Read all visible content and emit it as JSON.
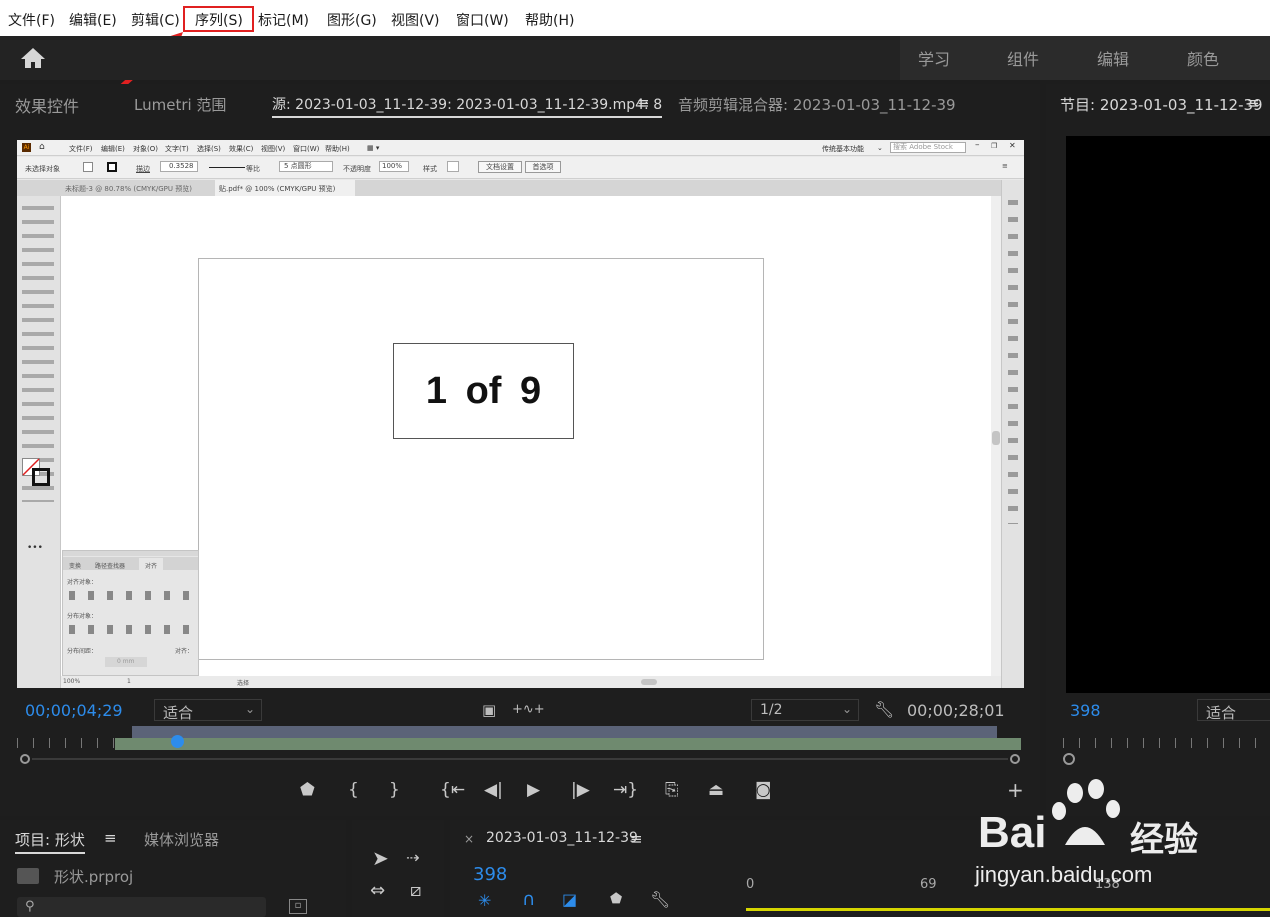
{
  "menubar": {
    "items": [
      "文件(F)",
      "编辑(E)",
      "剪辑(C)",
      "序列(S)",
      "标记(M)",
      "图形(G)",
      "视图(V)",
      "窗口(W)",
      "帮助(H)"
    ]
  },
  "workspaces": [
    "学习",
    "组件",
    "编辑",
    "颜色"
  ],
  "source_panel": {
    "tabs": [
      "效果控件",
      "Lumetri 范围",
      "源: 2023-01-03_11-12-39: 2023-01-03_11-12-39.mp4: 8",
      "音频剪辑混合器: 2023-01-03_11-12-39"
    ],
    "timecode_in": "00;00;04;29",
    "fit": "适合",
    "resolution": "1/2",
    "timecode_duration": "00;00;28;01"
  },
  "program_panel": {
    "tab": "节目: 2023-01-03_11-12-39",
    "frame": "398",
    "fit": "适合"
  },
  "illustrator": {
    "menu": [
      "文件(F)",
      "编辑(E)",
      "对象(O)",
      "文字(T)",
      "选择(S)",
      "效果(C)",
      "视图(V)",
      "窗口(W)",
      "帮助(H)"
    ],
    "workspace": "传统基本功能",
    "search_placeholder": "搜索 Adobe Stock",
    "ctrl": {
      "label": "未选择对象",
      "stroke_label": "描边",
      "stroke_value": "0.3528",
      "line": "等比",
      "points": "5 点圆形",
      "opacity_label": "不透明度",
      "opacity": "100%",
      "style_label": "样式",
      "doc_setup": "文档设置",
      "prefs": "首选项"
    },
    "doc_tabs": [
      "未标题-3 @ 80.78% (CMYK/GPU 预览)",
      "贴.pdf* @ 100% (CMYK/GPU 预览)"
    ],
    "page_text": "1 of 9",
    "align_panel": {
      "tabs": [
        "变换",
        "路径查找器",
        "对齐"
      ],
      "align_objects": "对齐对象：",
      "distribute_objects": "分布对象：",
      "distribute_spacing": "分布间距：",
      "align_to": "对齐：",
      "spacing_value": "0 mm"
    },
    "status": {
      "zoom": "100%",
      "page": "1",
      "tool": "选择"
    }
  },
  "project_panel": {
    "tabs": [
      "项目: 形状",
      "媒体浏览器"
    ],
    "file": "形状.prproj"
  },
  "timeline_panel": {
    "tab": "2023-01-03_11-12-39",
    "frame": "398",
    "ruler": [
      "0",
      "69",
      "138"
    ]
  },
  "watermark": {
    "brand": "Bai",
    "suffix": "经验",
    "url": "jingyan.baidu.com"
  },
  "colors": {
    "accent_blue": "#2d8ceb",
    "highlight_red": "#e02020",
    "bg": "#1d1d1d",
    "panel": "#232323"
  }
}
